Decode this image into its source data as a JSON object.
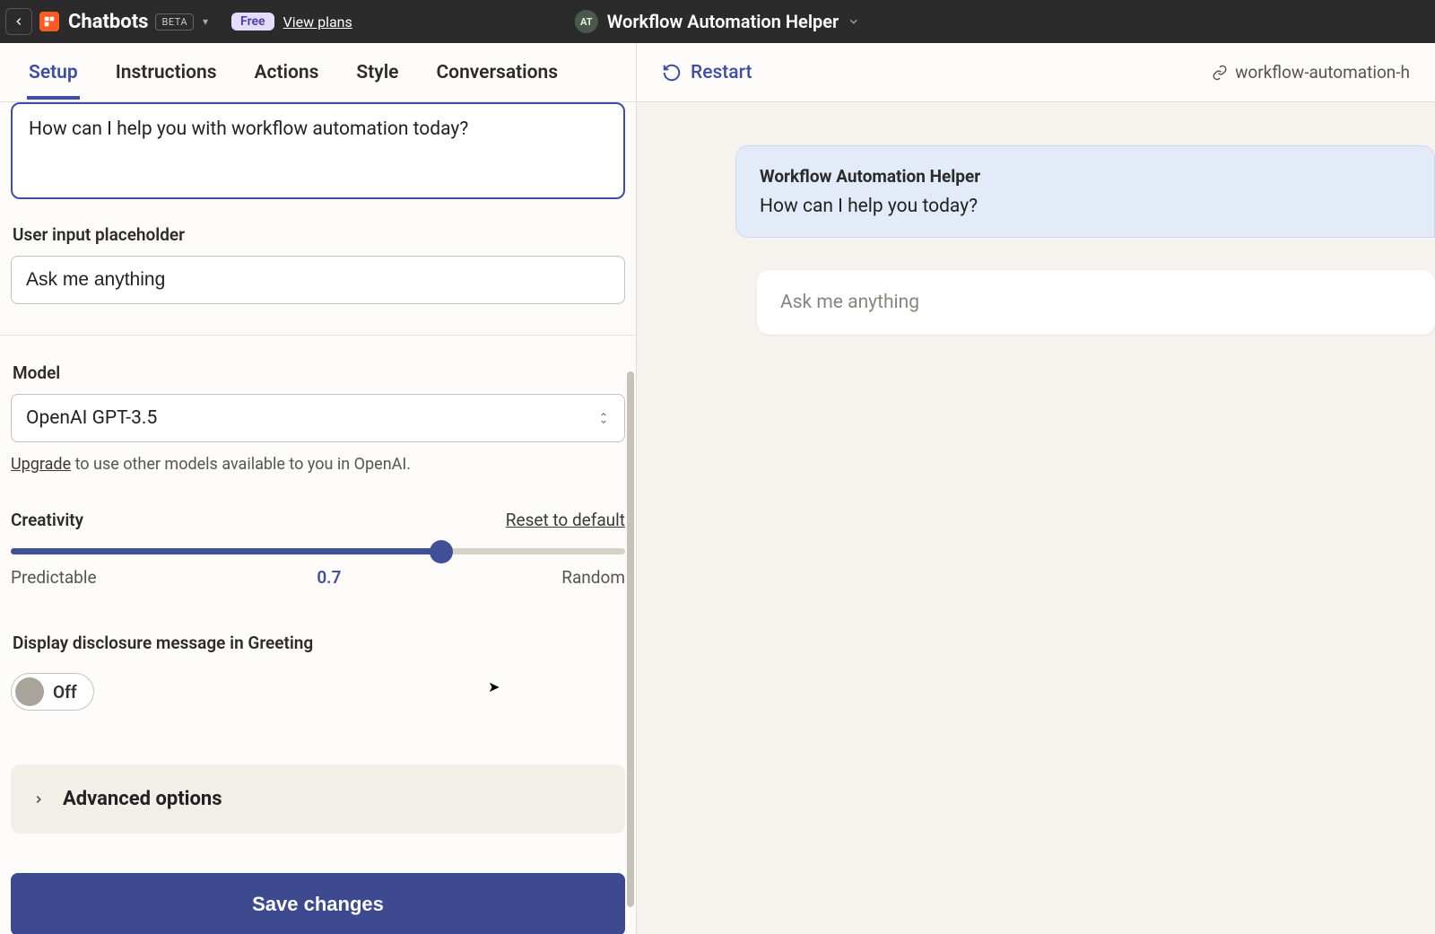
{
  "header": {
    "brand": "Chatbots",
    "beta": "BETA",
    "plan_badge": "Free",
    "view_plans": "View plans",
    "avatar_initials": "AT",
    "title": "Workflow Automation Helper"
  },
  "tabs": {
    "setup": "Setup",
    "instructions": "Instructions",
    "actions": "Actions",
    "style": "Style",
    "conversations": "Conversations"
  },
  "form": {
    "greeting_value": "How can I help you with workflow automation today?",
    "placeholder_label": "User input placeholder",
    "placeholder_value": "Ask me anything",
    "model_label": "Model",
    "model_value": "OpenAI GPT-3.5",
    "upgrade_link": "Upgrade",
    "upgrade_tail": " to use other models available to you in OpenAI.",
    "creativity_label": "Creativity",
    "reset_label": "Reset to default",
    "slider_min_label": "Predictable",
    "slider_value": "0.7",
    "slider_max_label": "Random",
    "disclosure_label": "Display disclosure message in Greeting",
    "toggle_state": "Off",
    "advanced_label": "Advanced options",
    "save_label": "Save changes"
  },
  "right": {
    "restart": "Restart",
    "slug": "workflow-automation-h",
    "bot_name": "Workflow Automation Helper",
    "bot_greeting": "How can I help you today?",
    "ask_placeholder": "Ask me anything"
  }
}
